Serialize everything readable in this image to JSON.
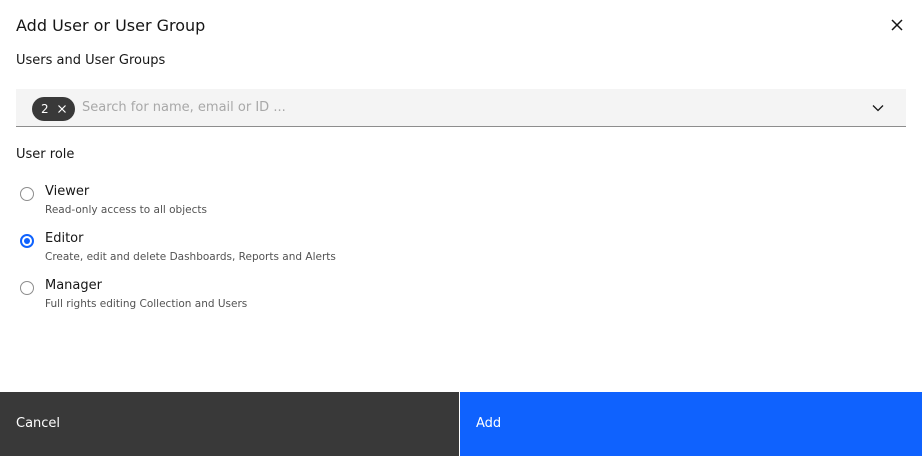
{
  "modal": {
    "title": "Add User or User Group",
    "close_icon": "close-icon"
  },
  "users_section": {
    "label": "Users and User Groups",
    "selected_tag_count": "2",
    "tag_clear_icon": "close-icon",
    "search": {
      "value": "",
      "placeholder": "Search for name, email or ID ..."
    },
    "dropdown_icon": "chevron-down-icon"
  },
  "role_section": {
    "label": "User role",
    "selected": "Editor",
    "options": [
      {
        "title": "Viewer",
        "description": "Read-only access to all objects",
        "checked": false
      },
      {
        "title": "Editor",
        "description": "Create, edit and delete Dashboards, Reports and Alerts",
        "checked": true
      },
      {
        "title": "Manager",
        "description": "Full rights editing Collection and Users",
        "checked": false
      }
    ]
  },
  "footer": {
    "cancel_label": "Cancel",
    "add_label": "Add"
  },
  "colors": {
    "primary": "#0f62fe",
    "secondary": "#393939",
    "field_bg": "#f4f4f4"
  }
}
